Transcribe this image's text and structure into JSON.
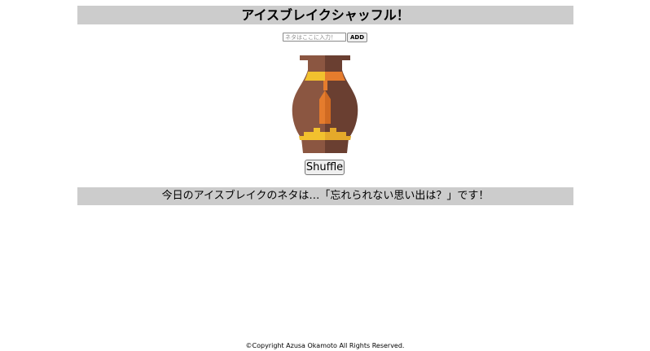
{
  "header": {
    "title": "アイスブレイクシャッフル！"
  },
  "add_form": {
    "placeholder": "ネタはここに入力！",
    "add_label": "ADD"
  },
  "illustration": {
    "icon": "vase-icon",
    "colors": {
      "body_left": "#8b5641",
      "body_right": "#6a3f31",
      "rim": "#8b5641",
      "band_orange": "#e57c2d",
      "band_yellow": "#f2c12e",
      "tassel": "#e57c2d"
    }
  },
  "shuffle": {
    "label": "Shuffle"
  },
  "result": {
    "text": "今日のアイスブレイクのネタは…「忘れられない思い出は？」です！"
  },
  "footer": {
    "copyright": "©Copyright Azusa Okamoto All Rights Reserved."
  }
}
